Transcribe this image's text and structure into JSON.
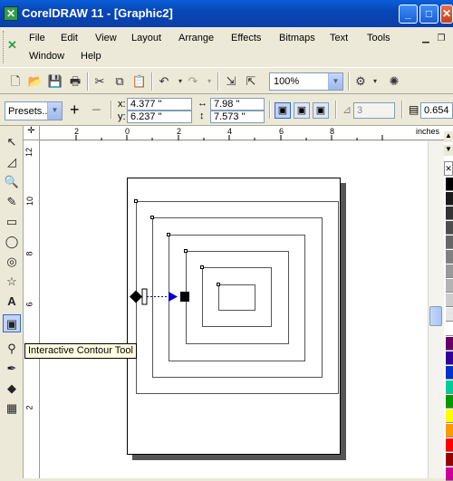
{
  "window": {
    "title": "CorelDRAW 11 - [Graphic2]",
    "controls": {
      "minimize": "_",
      "maximize": "□",
      "close": "✕"
    }
  },
  "menu": {
    "row1": [
      "File",
      "Edit",
      "View",
      "Layout",
      "Arrange",
      "Effects",
      "Bitmaps",
      "Text",
      "Tools"
    ],
    "row2": [
      "Window",
      "Help"
    ]
  },
  "toolbar": {
    "zoom": "100%"
  },
  "propbar": {
    "presets": "Presets...",
    "x_label": "x:",
    "x": "4.377 \"",
    "y_label": "y:",
    "y": "6.237 \"",
    "width": "7.98 \"",
    "height": "7.573 \"",
    "steps": "3",
    "offset": "0.654"
  },
  "ruler": {
    "h_ticks": [
      "2",
      "0",
      "2",
      "4",
      "6",
      "8"
    ],
    "units": "inches",
    "v_ticks": [
      "12",
      "10",
      "8",
      "6",
      "4",
      "2"
    ]
  },
  "tooltip": {
    "text": "Interactive Contour Tool"
  },
  "colors": {
    "title_bar": "#0a5fd8",
    "contour_arrow": "#0000cc",
    "palette": [
      "#000000",
      "#1a1a1a",
      "#333333",
      "#4d4d4d",
      "#666666",
      "#808080",
      "#999999",
      "#b3b3b3",
      "#cccccc",
      "#e6e6e6",
      "#ffffff",
      "#660066",
      "#330099",
      "#0033cc",
      "#00cc99",
      "#009900",
      "#ffff00",
      "#ff9900",
      "#ff0000",
      "#990000",
      "#cc0099"
    ]
  },
  "icons": {
    "tools": [
      "pick-tool-icon",
      "shape-tool-icon",
      "zoom-tool-icon",
      "freehand-tool-icon",
      "rectangle-tool-icon",
      "ellipse-tool-icon",
      "spiral-tool-icon",
      "basic-shapes-tool-icon",
      "text-tool-icon",
      "interactive-contour-tool-icon",
      "eyedropper-tool-icon",
      "outline-tool-icon",
      "fill-tool-icon",
      "interactive-fill-tool-icon"
    ]
  }
}
